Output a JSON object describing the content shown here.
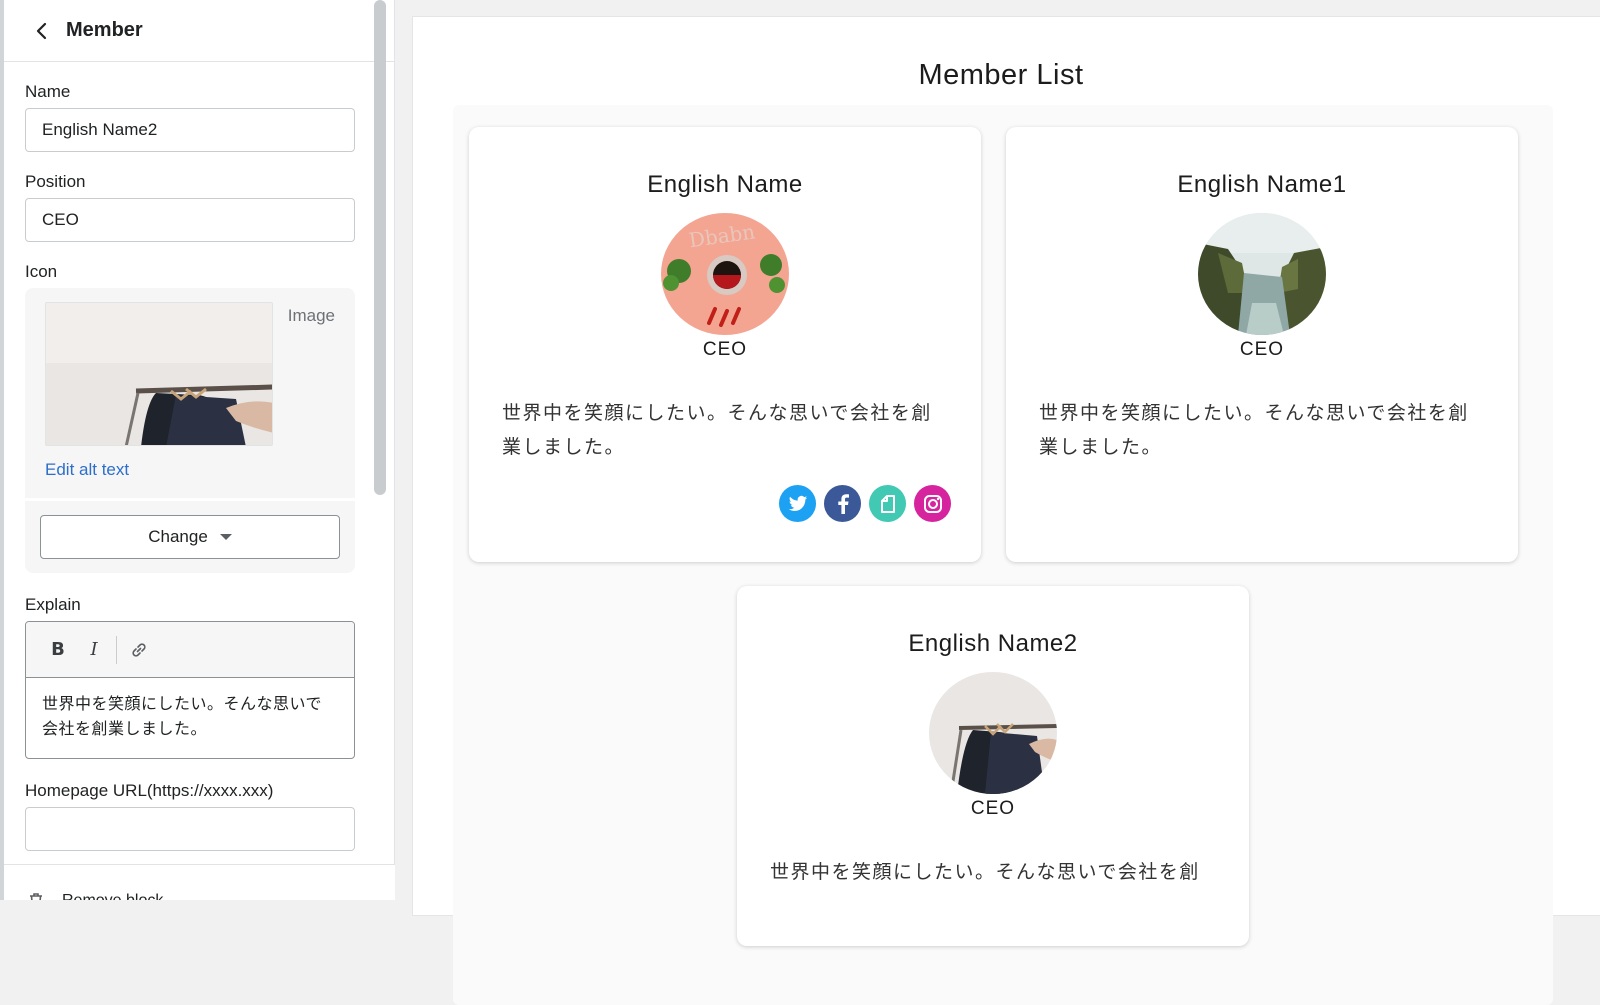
{
  "panel": {
    "title": "Member",
    "fields": {
      "name_label": "Name",
      "name_value": "English Name2",
      "position_label": "Position",
      "position_value": "CEO",
      "icon_label": "Icon",
      "image_tag": "Image",
      "edit_alt_text": "Edit alt text",
      "change_button": "Change",
      "explain_label": "Explain",
      "explain_value": "世界中を笑顔にしたい。そんな思いで会社を創業しました。",
      "homepage_label": "Homepage URL(https://xxxx.xxx)",
      "homepage_value": ""
    },
    "toolbar": {
      "bold": "B",
      "italic": "I"
    },
    "footer": {
      "remove_block": "Remove block"
    }
  },
  "preview": {
    "title": "Member List",
    "members": [
      {
        "name": "English Name",
        "position": "CEO",
        "description": "世界中を笑顔にしたい。そんな思いで会社を創業しました。",
        "socials": [
          "twitter-icon",
          "facebook-icon",
          "note-icon",
          "instagram-icon"
        ]
      },
      {
        "name": "English Name1",
        "position": "CEO",
        "description": "世界中を笑顔にしたい。そんな思いで会社を創業しました。",
        "socials": []
      },
      {
        "name": "English Name2",
        "position": "CEO",
        "description": "世界中を笑顔にしたい。そんな思いで会社を創"
      }
    ]
  },
  "colors": {
    "link": "#2c6ecb",
    "twitter": "#1da1f2",
    "facebook": "#3b5998",
    "note": "#41c9b4",
    "instagram": "#d6249f"
  }
}
